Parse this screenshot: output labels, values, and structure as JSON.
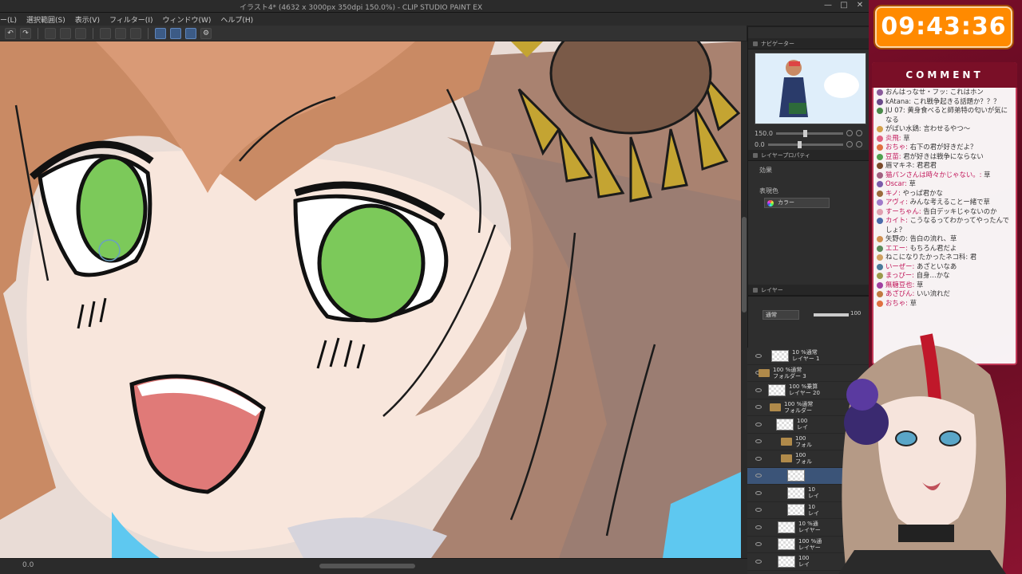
{
  "window": {
    "title": "イラスト4* (4632 x 3000px 350dpi 150.0%) - CLIP STUDIO PAINT EX",
    "min_icon": "—",
    "max_icon": "□",
    "close_icon": "✕"
  },
  "menu": [
    "ー(L)",
    "選択範囲(S)",
    "表示(V)",
    "フィルター(I)",
    "ウィンドウ(W)",
    "ヘルプ(H)"
  ],
  "toolbar": {
    "undo": "↶",
    "redo": "↷",
    "settings": "⚙"
  },
  "status": {
    "zoom": "0.0"
  },
  "panels": {
    "navigator_tab": "ナビゲーター",
    "zoom_value": "150.0",
    "rotate_value": "0.0",
    "layer_property_tab": "レイヤープロパティ",
    "effect_label": "効果",
    "expression_color_label": "表現色",
    "expression_color_value": "カラー",
    "layer_tab": "レイヤー",
    "blend_mode": "通常",
    "opacity_value": "100"
  },
  "layers": [
    {
      "pct": "10 %通常",
      "name": "レイヤー 1",
      "kind": "layer",
      "indent": 30,
      "sel": false
    },
    {
      "pct": "100 %通常",
      "name": "フォルダー 3",
      "kind": "folder",
      "indent": 14,
      "sel": false
    },
    {
      "pct": "100 %乗算",
      "name": "レイヤー 20",
      "kind": "layer",
      "indent": 26,
      "sel": false
    },
    {
      "pct": "100 %通常",
      "name": "フォルダー",
      "kind": "folder",
      "indent": 28,
      "sel": false
    },
    {
      "pct": "100",
      "name": "レイ",
      "kind": "layer",
      "indent": 36,
      "sel": false
    },
    {
      "pct": "100",
      "name": "フォル",
      "kind": "folder",
      "indent": 42,
      "sel": false
    },
    {
      "pct": "100",
      "name": "フォル",
      "kind": "folder",
      "indent": 42,
      "sel": false
    },
    {
      "pct": "",
      "name": "",
      "kind": "layer",
      "indent": 50,
      "sel": true
    },
    {
      "pct": "10",
      "name": "レイ",
      "kind": "layer",
      "indent": 50,
      "sel": false
    },
    {
      "pct": "10",
      "name": "レイ",
      "kind": "layer",
      "indent": 50,
      "sel": false
    },
    {
      "pct": "10 %通",
      "name": "レイヤー",
      "kind": "layer",
      "indent": 38,
      "sel": false
    },
    {
      "pct": "100 %通",
      "name": "レイヤー",
      "kind": "layer",
      "indent": 38,
      "sel": false
    },
    {
      "pct": "100",
      "name": "レイ",
      "kind": "layer",
      "indent": 38,
      "sel": false
    }
  ],
  "stream": {
    "timer": "09:43:36",
    "comment_header": "COMMENT",
    "comments": [
      {
        "name": "おんはっなせ・フッ:",
        "text": " これはホン",
        "color": "blk",
        "av": "#8a5a9a"
      },
      {
        "name": "kAtana:",
        "text": " これ戦争起きる話題か？？？",
        "color": "blk",
        "av": "#6a4a8a"
      },
      {
        "name": "JU 07:",
        "text": " 黄身食べると師弟特の匂いが気になる",
        "color": "blk",
        "av": "#4a8a4a",
        "wrap": true
      },
      {
        "name": "がばい水鶏:",
        "text": " 言わせるやつ～",
        "color": "blk",
        "av": "#d4a04a"
      },
      {
        "name": "炎飛:",
        "text": " 草",
        "color": "pink",
        "av": "#e06080"
      },
      {
        "name": "おちゃ:",
        "text": " 右下の君が好きだよ？",
        "color": "pink",
        "av": "#e07040"
      },
      {
        "name": "豆苗:",
        "text": " 君が好きは戦争にならない",
        "color": "pink",
        "av": "#50a050"
      },
      {
        "name": "眉マキネ:",
        "text": " 君君君",
        "color": "blk",
        "av": "#7a4a2a"
      },
      {
        "name": "猫パンさんは時々かじゃない。:",
        "text": " 草",
        "color": "pink",
        "av": "#a06080"
      },
      {
        "name": "Oscar:",
        "text": " 草",
        "color": "pink",
        "av": "#7a5aaa"
      },
      {
        "name": "キノ:",
        "text": " やっぱ君かな",
        "color": "pink",
        "av": "#9a6a3a"
      },
      {
        "name": "アヴィ:",
        "text": " みんな考えることー緒で草",
        "color": "pink",
        "av": "#a07aca"
      },
      {
        "name": "すーちゃん:",
        "text": " 告白デッキじゃないのか",
        "color": "pink",
        "av": "#e0a0b0"
      },
      {
        "name": "カイト:",
        "text": " こうなるってわかってやったんでしょ？",
        "color": "pink",
        "av": "#4a6aaa",
        "wrap": true
      },
      {
        "name": "矢野の:",
        "text": " 告白の流れ、草",
        "color": "blk",
        "av": "#d09050"
      },
      {
        "name": "エエー:",
        "text": " もちろん君だよ",
        "color": "pink",
        "av": "#5a8a5a"
      },
      {
        "name": "ねこになりたかったネコ科:",
        "text": " 君",
        "color": "blk",
        "av": "#d0a060"
      },
      {
        "name": "いーぜー:",
        "text": " あざといなあ",
        "color": "pink",
        "av": "#4a7a9a"
      },
      {
        "name": "まっぴー:",
        "text": " 自身…かな",
        "color": "pink",
        "av": "#9a9a4a"
      },
      {
        "name": "無糖豆也:",
        "text": " 草",
        "color": "pink",
        "av": "#a040a0"
      },
      {
        "name": "あざびん:",
        "text": " いい流れだ",
        "color": "pink",
        "av": "#c07a40"
      },
      {
        "name": "おちゃ:",
        "text": " 草",
        "color": "pink",
        "av": "#e07040"
      }
    ]
  },
  "colors": {
    "timer_bg": "#ff8a00",
    "overlay_bg": "#7c0e2a",
    "hair": "#c98a64",
    "eye": "#7cc95a",
    "skin": "#f8e6dc",
    "sunflower": "#c4a432"
  }
}
